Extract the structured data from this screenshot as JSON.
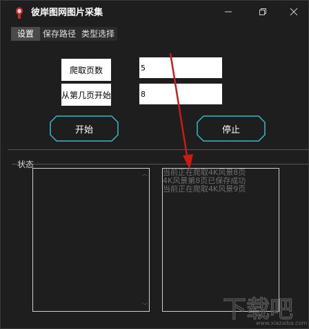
{
  "window": {
    "title": "彼岸图网图片采集"
  },
  "menu": {
    "items": [
      "设置",
      "保存路径",
      "类型选择"
    ]
  },
  "form": {
    "pages_label": "爬取页数",
    "pages_value": "5",
    "start_label": "从第几页开始",
    "start_value": "8"
  },
  "buttons": {
    "start_label": "开始",
    "stop_label": "停止"
  },
  "status": {
    "label": "状态",
    "log": [
      "当前正在爬取4K风景8页",
      "4K风景第8页已保存成功",
      "当前正在爬取4K风景9页"
    ]
  },
  "watermark": {
    "text": "下载吧",
    "domain": "www.xiazaiba.com"
  },
  "colors": {
    "background": "#1e1e1e",
    "button_border": "#3fb8c8",
    "arrow": "#d01818"
  }
}
